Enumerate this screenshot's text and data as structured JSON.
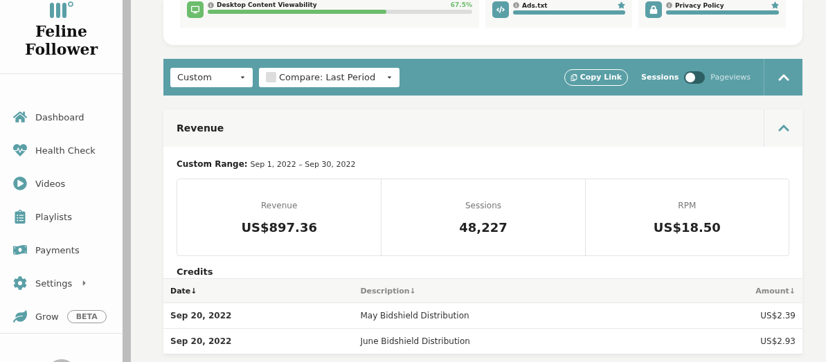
{
  "brand": {
    "name": "Feline Follower"
  },
  "nav": [
    {
      "label": "Dashboard"
    },
    {
      "label": "Health Check"
    },
    {
      "label": "Videos"
    },
    {
      "label": "Playlists"
    },
    {
      "label": "Payments"
    },
    {
      "label": "Settings",
      "submenu": true
    },
    {
      "label": "Grow",
      "badge": "BETA"
    }
  ],
  "checks": [
    {
      "label": "Desktop Content Viewability",
      "kind": "percent",
      "value": "67.5%",
      "level": 0.675,
      "color": "#6cbd6c"
    },
    {
      "label": "Ads.txt",
      "kind": "star",
      "level": 1,
      "color": "#5a9fa6"
    },
    {
      "label": "Privacy Policy",
      "kind": "star",
      "level": 1,
      "color": "#5a9fa6"
    }
  ],
  "toolbar": {
    "range": "Custom",
    "compare": {
      "label": "Compare: Last Period",
      "checked": false
    },
    "copy_link": "Copy Link",
    "metric_toggle": [
      {
        "label": "Sessions",
        "selected": true
      },
      {
        "label": "Pageviews",
        "selected": false
      }
    ]
  },
  "revenue": {
    "title": "Revenue",
    "range_label": "Custom Range:",
    "range": "Sep 1, 2022 – Sep 30, 2022",
    "stats": [
      {
        "label": "Revenue",
        "value": "US$897.36"
      },
      {
        "label": "Sessions",
        "value": "48,227"
      },
      {
        "label": "RPM",
        "value": "US$18.50"
      }
    ],
    "credits": {
      "title": "Credits",
      "columns": [
        {
          "label": "Date↓",
          "selected": true
        },
        {
          "label": "Description↓",
          "selected": false
        },
        {
          "label": "Amount↓",
          "selected": false
        }
      ],
      "rows": [
        [
          "Sep 20, 2022",
          "May Bidshield Distribution",
          "US$2.39"
        ],
        [
          "Sep 20, 2022",
          "June Bidshield Distribution",
          "US$2.93"
        ]
      ]
    }
  }
}
